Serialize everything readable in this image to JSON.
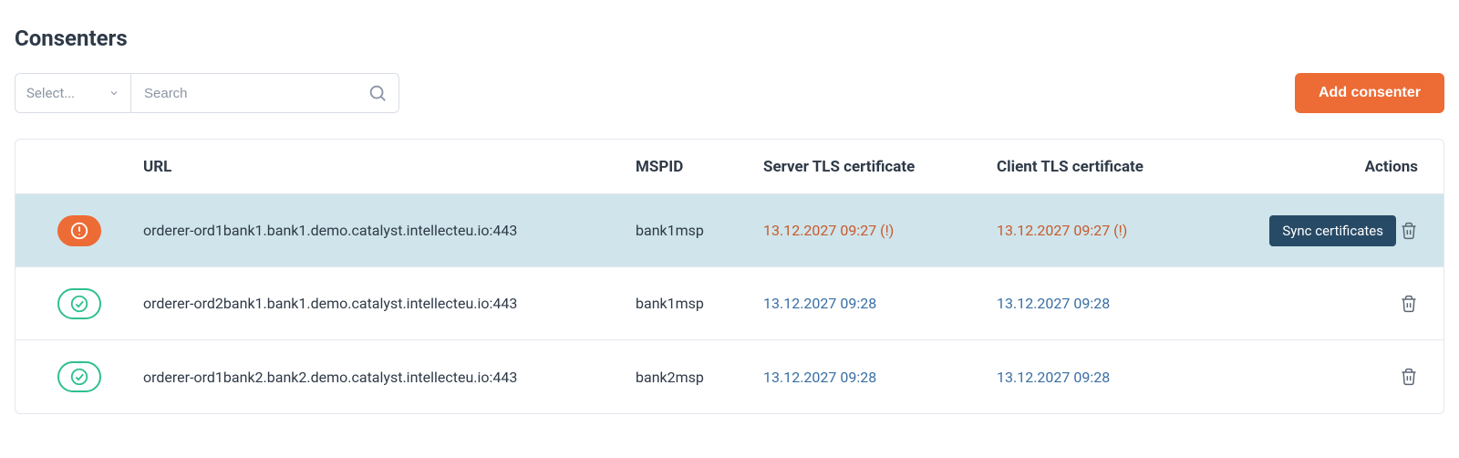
{
  "page": {
    "title": "Consenters"
  },
  "toolbar": {
    "select_placeholder": "Select...",
    "search_placeholder": "Search",
    "add_button_label": "Add consenter"
  },
  "columns": {
    "url": "URL",
    "mspid": "MSPID",
    "server_tls": "Server TLS certificate",
    "client_tls": "Client TLS certificate",
    "actions": "Actions"
  },
  "tooltip": {
    "sync": "Sync certificates"
  },
  "rows": [
    {
      "status": "warn",
      "url": "orderer-ord1bank1.bank1.demo.catalyst.intellecteu.io:443",
      "mspid": "bank1msp",
      "server_tls": "13.12.2027 09:27 (!)",
      "client_tls": "13.12.2027 09:27 (!)",
      "highlight": true,
      "show_sync": true,
      "show_tooltip": true
    },
    {
      "status": "ok",
      "url": "orderer-ord2bank1.bank1.demo.catalyst.intellecteu.io:443",
      "mspid": "bank1msp",
      "server_tls": "13.12.2027 09:28",
      "client_tls": "13.12.2027 09:28",
      "highlight": false,
      "show_sync": false,
      "show_tooltip": false
    },
    {
      "status": "ok",
      "url": "orderer-ord1bank2.bank2.demo.catalyst.intellecteu.io:443",
      "mspid": "bank2msp",
      "server_tls": "13.12.2027 09:28",
      "client_tls": "13.12.2027 09:28",
      "highlight": false,
      "show_sync": false,
      "show_tooltip": false
    }
  ]
}
